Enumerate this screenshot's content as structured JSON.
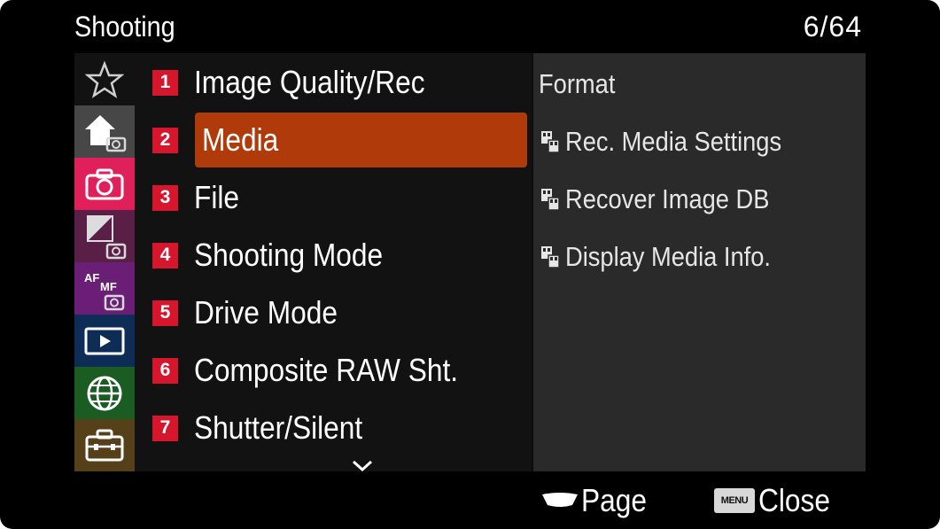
{
  "header": {
    "title": "Shooting",
    "page_counter": "6/64"
  },
  "rail": {
    "items": [
      {
        "icon": "star-icon",
        "color": "#121212"
      },
      {
        "icon": "home-camera-icon",
        "color": "#474747"
      },
      {
        "icon": "camera-icon",
        "color": "#e0205a",
        "selected": true
      },
      {
        "icon": "exposure-camera-icon",
        "color": "#5a1f46"
      },
      {
        "icon": "af-mf-camera-icon",
        "color": "#6b1e76",
        "label": "AF MF"
      },
      {
        "icon": "playback-icon",
        "color": "#0d2d57"
      },
      {
        "icon": "globe-icon",
        "color": "#1a5c22"
      },
      {
        "icon": "toolbox-icon",
        "color": "#56401a"
      }
    ]
  },
  "list": {
    "items": [
      {
        "num": "1",
        "label": "Image Quality/Rec"
      },
      {
        "num": "2",
        "label": "Media",
        "selected": true
      },
      {
        "num": "3",
        "label": "File"
      },
      {
        "num": "4",
        "label": "Shooting Mode"
      },
      {
        "num": "5",
        "label": "Drive Mode"
      },
      {
        "num": "6",
        "label": "Composite RAW Sht."
      },
      {
        "num": "7",
        "label": "Shutter/Silent"
      }
    ],
    "more_icon": "chevron-down-icon"
  },
  "detail": {
    "items": [
      {
        "label": "Format",
        "icon": null
      },
      {
        "label": "Rec. Media Settings",
        "icon": "media-card-icon"
      },
      {
        "label": "Recover Image DB",
        "icon": "media-card-icon"
      },
      {
        "label": "Display Media Info.",
        "icon": "media-card-icon"
      }
    ]
  },
  "footer": {
    "page_label": "Page",
    "page_icon": "control-wheel-down-icon",
    "menu_key_text": "MENU",
    "close_label": "Close"
  },
  "colors": {
    "accent_selected": "#b03a0a",
    "badge": "#d5162c"
  }
}
